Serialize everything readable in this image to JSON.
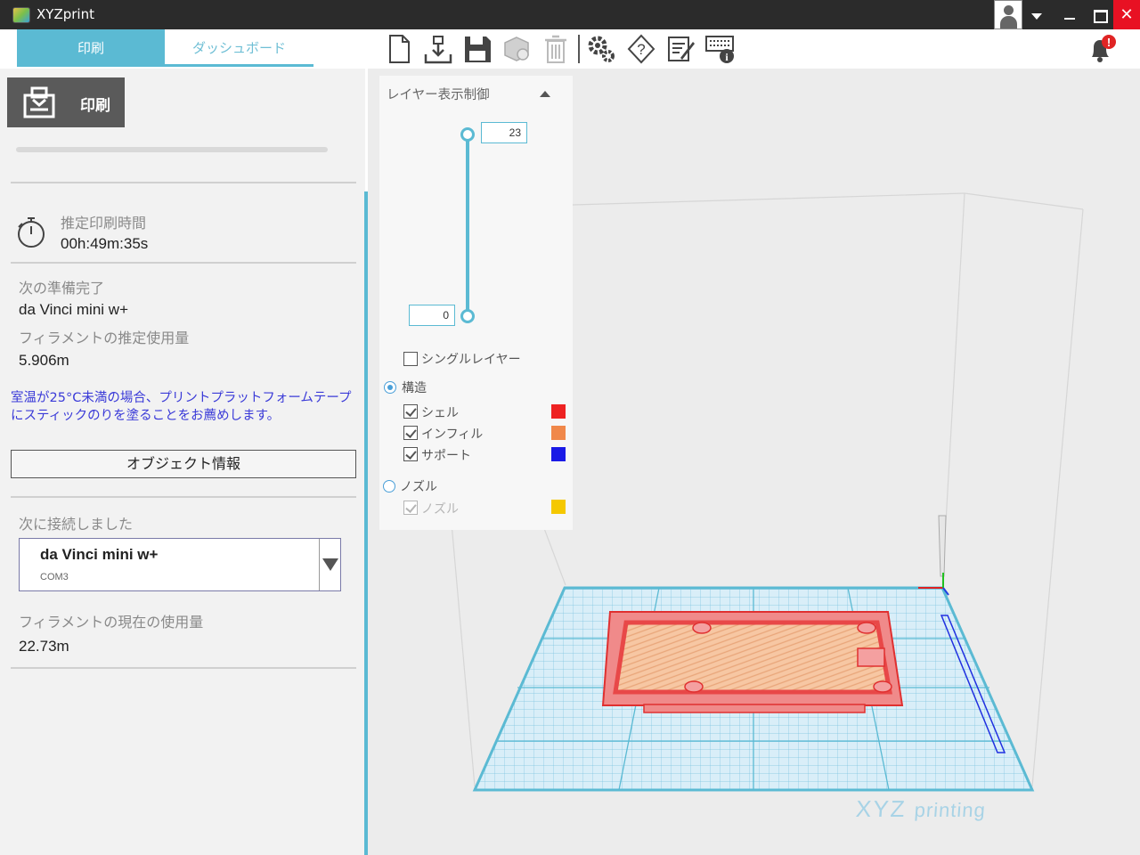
{
  "window": {
    "title": "XYZprint"
  },
  "tabs": [
    {
      "label": "印刷"
    },
    {
      "label": "ダッシュボード"
    }
  ],
  "toolbar": {
    "icons": [
      "new-file-icon",
      "import-icon",
      "save-icon",
      "object-icon",
      "delete-icon",
      "settings-icon",
      "help-icon",
      "edit-icon",
      "keyboard-info-icon"
    ],
    "notification_badge": "!"
  },
  "left_panel": {
    "print_button_label": "印刷",
    "estimated_time_label": "推定印刷時間",
    "estimated_time_value": "00h:49m:35s",
    "ready_label": "次の準備完了",
    "ready_value": "da Vinci mini w+",
    "filament_estimate_label": "フィラメントの推定使用量",
    "filament_estimate_value": "5.906m",
    "note": "室温が25°C未満の場合、プリントプラットフォームテープにスティックのりを塗ることをお薦めします。",
    "object_info_button": "オブジェクト情報",
    "connected_label": "次に接続しました",
    "printer_name": "da Vinci mini w+",
    "printer_port": "COM3",
    "filament_current_label": "フィラメントの現在の使用量",
    "filament_current_value": "22.73m"
  },
  "layer_panel": {
    "title": "レイヤー表示制御",
    "slider_top": "23",
    "slider_bottom": "0",
    "single_layer": "シングルレイヤー",
    "structure": "構造",
    "shell": "シェル",
    "infill": "インフィル",
    "support": "サポート",
    "nozzle_group": "ノズル",
    "nozzle": "ノズル",
    "colors": {
      "shell": "#ee2222",
      "infill": "#f0884a",
      "support": "#1a1ae6",
      "nozzle": "#f5c800"
    }
  },
  "brand": {
    "main": "XYZ",
    "sub": "printing"
  },
  "colors": {
    "accent": "#5bbad3",
    "titlebar": "#2b2b2b",
    "close": "#e81123"
  }
}
